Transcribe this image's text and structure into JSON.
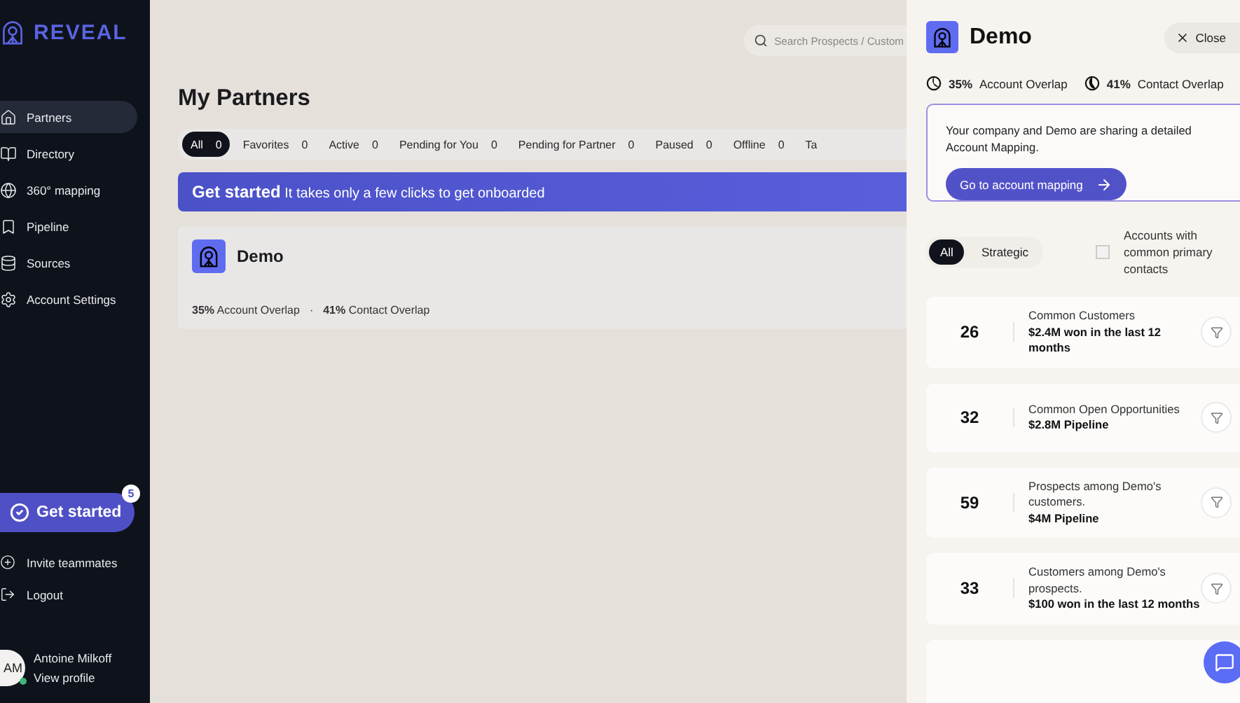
{
  "sidebar": {
    "logo": "REVEAL",
    "items": [
      {
        "label": "Partners",
        "selected": true
      },
      {
        "label": "Directory",
        "selected": false
      },
      {
        "label": "360° mapping",
        "selected": false
      },
      {
        "label": "Pipeline",
        "selected": false
      },
      {
        "label": "Sources",
        "selected": false
      },
      {
        "label": "Account Settings",
        "selected": false
      }
    ],
    "get_started": {
      "label": "Get started",
      "badge": "5"
    },
    "links": [
      {
        "label": "Invite teammates"
      },
      {
        "label": "Logout"
      }
    ],
    "user": {
      "initials": "AM",
      "name": "Antoine Milkoff",
      "link": "View profile",
      "online": true
    }
  },
  "main": {
    "search": {
      "placeholder": "Search Prospects / Custom"
    },
    "title": "My Partners",
    "tabs": [
      {
        "label": "All",
        "count": "0",
        "selected": true
      },
      {
        "label": "Favorites",
        "count": "0",
        "selected": false
      },
      {
        "label": "Active",
        "count": "0",
        "selected": false
      },
      {
        "label": "Pending for You",
        "count": "0",
        "selected": false
      },
      {
        "label": "Pending for Partner",
        "count": "0",
        "selected": false
      },
      {
        "label": "Paused",
        "count": "0",
        "selected": false
      },
      {
        "label": "Offline",
        "count": "0",
        "selected": false
      },
      {
        "label": "Ta",
        "selected": false
      }
    ],
    "banner": "**Get started** It takes only a few clicks to get onboarded",
    "partner": {
      "name": "Demo",
      "overlap": "**35%** Account Overlap",
      "separator": "·",
      "contact": "**41%** Contact Overlap"
    }
  },
  "panel": {
    "title": "Demo",
    "close": "Close",
    "overlaps": [
      {
        "value": "35%",
        "label": "Account Overlap"
      },
      {
        "value": "41%",
        "label": "Contact Overlap"
      }
    ],
    "info": "Your company and Demo are sharing a detailed Account Mapping.",
    "action": "Go to account mapping",
    "filters": [
      {
        "label": "All",
        "selected": true
      },
      {
        "label": "Strategic",
        "selected": false
      }
    ],
    "common_contacts": {
      "label": "Accounts with common primary contacts",
      "checked": false
    },
    "cards": [
      {
        "count": "26",
        "title": "Common Customers",
        "detail": "$2.4M won in the last 12 months"
      },
      {
        "count": "32",
        "title": "Common Open Opportunities",
        "detail": "$2.8M Pipeline"
      },
      {
        "count": "59",
        "title": "Prospects among Demo's customers.",
        "detail": "$4M Pipeline"
      },
      {
        "count": "33",
        "title": "Customers among Demo's prospects.",
        "detail": "$100 won in the last 12 months"
      }
    ]
  }
}
